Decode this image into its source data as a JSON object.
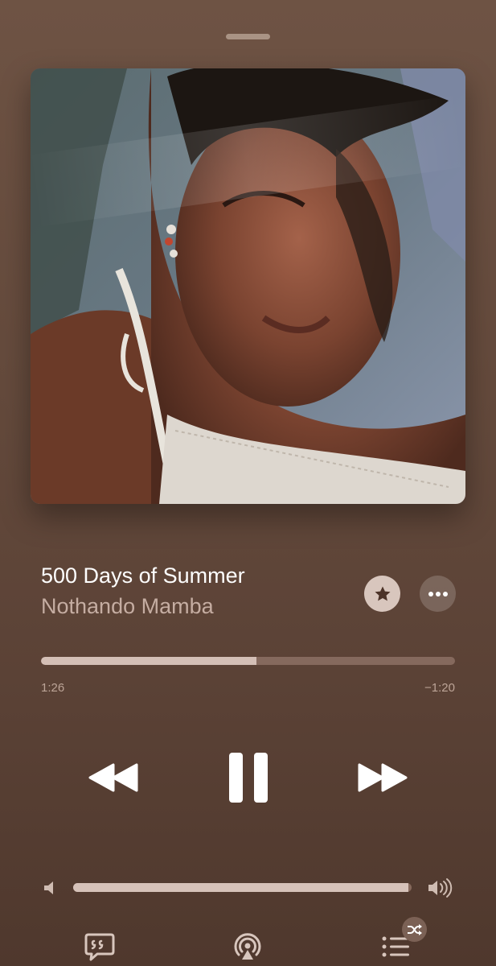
{
  "now_playing": {
    "title": "500 Days of Summer",
    "artist": "Nothando Mamba",
    "artwork_icon": "album-artwork"
  },
  "playback": {
    "elapsed": "1:26",
    "remaining": "−1:20",
    "progress_fraction": 0.52,
    "state": "playing"
  },
  "volume": {
    "level_fraction": 0.99
  },
  "buttons": {
    "favorite_icon": "star-icon",
    "more_icon": "ellipsis-icon",
    "rewind_icon": "rewind-icon",
    "pause_icon": "pause-icon",
    "forward_icon": "fast-forward-icon",
    "lyrics_icon": "lyrics-quote-icon",
    "airplay_icon": "airplay-icon",
    "queue_icon": "queue-list-icon",
    "shuffle_icon": "shuffle-icon"
  },
  "colors": {
    "background": "#644a3c",
    "progress_fill": "#d4bfb6",
    "progress_track": "#85695d",
    "artist_text": "#c5ada2",
    "favorite_bg": "#d8c6bd"
  }
}
